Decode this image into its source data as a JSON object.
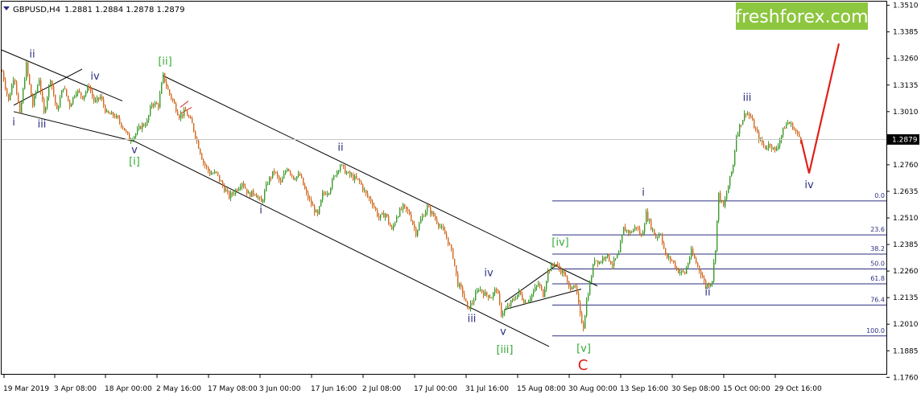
{
  "header": {
    "symbol_label": "GBPUSD,H4",
    "ohlc_text": "1.2881 1.2884 1.2878 1.2879"
  },
  "brand": {
    "text": "freshforex.com",
    "color": "#8dc63f"
  },
  "current_price": {
    "label": "1.2879",
    "value": 1.2879
  },
  "chart_data": {
    "type": "candlestick",
    "title": "GBPUSD,H4",
    "ylim": [
      1.1765,
      1.3535
    ],
    "y_ticks": [
      "1.3510",
      "1.3385",
      "1.3260",
      "1.3135",
      "1.3010",
      "1.2885",
      "1.2760",
      "1.2635",
      "1.2510",
      "1.2385",
      "1.2260",
      "1.2135",
      "1.2010",
      "1.1885",
      "1.1760"
    ],
    "x_ticks": [
      "19 Mar 2019",
      "3 Apr 08:00",
      "18 Apr 00:00",
      "2 May 16:00",
      "17 May 08:00",
      "3 Jun 00:00",
      "17 Jun 16:00",
      "2 Jul 08:00",
      "17 Jul 00:00",
      "31 Jul 16:00",
      "15 Aug 08:00",
      "30 Aug 00:00",
      "13 Sep 16:00",
      "30 Sep 08:00",
      "15 Oct 00:00",
      "29 Oct 16:00"
    ],
    "colors": {
      "up": "#3a9a2a",
      "down": "#d2691e",
      "projection": "#e0201b",
      "wave": "#2c2f80",
      "wave_green": "#33aa33"
    },
    "price_path": [
      [
        0,
        1.32
      ],
      [
        8,
        1.306
      ],
      [
        15,
        1.319
      ],
      [
        22,
        1.299
      ],
      [
        30,
        1.323
      ],
      [
        38,
        1.304
      ],
      [
        46,
        1.3165
      ],
      [
        52,
        1.3
      ],
      [
        60,
        1.317
      ],
      [
        68,
        1.301
      ],
      [
        76,
        1.313
      ],
      [
        84,
        1.304
      ],
      [
        92,
        1.311
      ],
      [
        100,
        1.308
      ],
      [
        108,
        1.313
      ],
      [
        115,
        1.305
      ],
      [
        122,
        1.308
      ],
      [
        130,
        1.3
      ],
      [
        140,
        1.299
      ],
      [
        150,
        1.294
      ],
      [
        158,
        1.288
      ],
      [
        165,
        1.29
      ],
      [
        172,
        1.294
      ],
      [
        180,
        1.296
      ],
      [
        186,
        1.305
      ],
      [
        194,
        1.304
      ],
      [
        200,
        1.318
      ],
      [
        206,
        1.311
      ],
      [
        212,
        1.306
      ],
      [
        220,
        1.299
      ],
      [
        228,
        1.301
      ],
      [
        236,
        1.295
      ],
      [
        243,
        1.286
      ],
      [
        250,
        1.277
      ],
      [
        258,
        1.272
      ],
      [
        266,
        1.272
      ],
      [
        274,
        1.266
      ],
      [
        282,
        1.261
      ],
      [
        290,
        1.264
      ],
      [
        298,
        1.268
      ],
      [
        306,
        1.262
      ],
      [
        314,
        1.263
      ],
      [
        322,
        1.258
      ],
      [
        330,
        1.268
      ],
      [
        338,
        1.273
      ],
      [
        346,
        1.267
      ],
      [
        354,
        1.275
      ],
      [
        362,
        1.27
      ],
      [
        370,
        1.271
      ],
      [
        378,
        1.262
      ],
      [
        386,
        1.256
      ],
      [
        392,
        1.252
      ],
      [
        398,
        1.262
      ],
      [
        406,
        1.264
      ],
      [
        414,
        1.272
      ],
      [
        420,
        1.276
      ],
      [
        428,
        1.272
      ],
      [
        436,
        1.27
      ],
      [
        444,
        1.268
      ],
      [
        452,
        1.262
      ],
      [
        460,
        1.258
      ],
      [
        468,
        1.251
      ],
      [
        476,
        1.253
      ],
      [
        484,
        1.245
      ],
      [
        490,
        1.252
      ],
      [
        498,
        1.256
      ],
      [
        506,
        1.253
      ],
      [
        514,
        1.244
      ],
      [
        520,
        1.25
      ],
      [
        528,
        1.256
      ],
      [
        536,
        1.252
      ],
      [
        544,
        1.247
      ],
      [
        552,
        1.242
      ],
      [
        560,
        1.233
      ],
      [
        566,
        1.22
      ],
      [
        572,
        1.216
      ],
      [
        578,
        1.208
      ],
      [
        585,
        1.212
      ],
      [
        592,
        1.218
      ],
      [
        600,
        1.215
      ],
      [
        608,
        1.214
      ],
      [
        614,
        1.218
      ],
      [
        620,
        1.206
      ],
      [
        626,
        1.208
      ],
      [
        634,
        1.212
      ],
      [
        642,
        1.216
      ],
      [
        650,
        1.211
      ],
      [
        658,
        1.215
      ],
      [
        666,
        1.22
      ],
      [
        672,
        1.215
      ],
      [
        678,
        1.226
      ],
      [
        686,
        1.23
      ],
      [
        692,
        1.227
      ],
      [
        698,
        1.225
      ],
      [
        704,
        1.218
      ],
      [
        710,
        1.22
      ],
      [
        714,
        1.215
      ],
      [
        718,
        1.205
      ],
      [
        722,
        1.2
      ],
      [
        726,
        1.212
      ],
      [
        730,
        1.22
      ],
      [
        736,
        1.232
      ],
      [
        742,
        1.23
      ],
      [
        750,
        1.234
      ],
      [
        758,
        1.229
      ],
      [
        766,
        1.234
      ],
      [
        772,
        1.246
      ],
      [
        780,
        1.244
      ],
      [
        788,
        1.247
      ],
      [
        794,
        1.242
      ],
      [
        800,
        1.253
      ],
      [
        806,
        1.247
      ],
      [
        812,
        1.242
      ],
      [
        818,
        1.244
      ],
      [
        824,
        1.233
      ],
      [
        832,
        1.231
      ],
      [
        840,
        1.226
      ],
      [
        848,
        1.225
      ],
      [
        856,
        1.235
      ],
      [
        862,
        1.23
      ],
      [
        868,
        1.225
      ],
      [
        874,
        1.219
      ],
      [
        878,
        1.22
      ],
      [
        882,
        1.222
      ],
      [
        886,
        1.237
      ],
      [
        890,
        1.262
      ],
      [
        896,
        1.256
      ],
      [
        902,
        1.266
      ],
      [
        908,
        1.276
      ],
      [
        912,
        1.29
      ],
      [
        918,
        1.296
      ],
      [
        924,
        1.301
      ],
      [
        930,
        1.298
      ],
      [
        936,
        1.292
      ],
      [
        942,
        1.287
      ],
      [
        948,
        1.284
      ],
      [
        954,
        1.286
      ],
      [
        960,
        1.282
      ],
      [
        966,
        1.288
      ],
      [
        972,
        1.294
      ],
      [
        976,
        1.296
      ],
      [
        982,
        1.294
      ],
      [
        988,
        1.29
      ],
      [
        993,
        1.2879
      ]
    ],
    "projection": [
      [
        993,
        1.2879
      ],
      [
        1003,
        1.272
      ],
      [
        1040,
        1.333
      ]
    ],
    "fibonacci": {
      "levels": [
        {
          "label": "0.0",
          "price": 1.259
        },
        {
          "label": "23.6",
          "price": 1.243
        },
        {
          "label": "38.2",
          "price": 1.234
        },
        {
          "label": "50.0",
          "price": 1.227
        },
        {
          "label": "61.8",
          "price": 1.22
        },
        {
          "label": "76.4",
          "price": 1.21
        },
        {
          "label": "100.0",
          "price": 1.1955
        }
      ]
    },
    "trendlines": [
      {
        "name": "channel-upper-main",
        "from": [
          200,
          1.318
        ],
        "to": [
          740,
          1.219
        ]
      },
      {
        "name": "channel-lower-main",
        "from": [
          160,
          1.288
        ],
        "to": [
          680,
          1.1905
        ]
      },
      {
        "name": "wedge-upper",
        "from": [
          0,
          1.33
        ],
        "to": [
          150,
          1.306
        ]
      },
      {
        "name": "wedge-lower",
        "from": [
          15,
          1.301
        ],
        "to": [
          165,
          1.287
        ]
      },
      {
        "name": "wedge-cross",
        "from": [
          15,
          1.304
        ],
        "to": [
          100,
          1.321
        ]
      },
      {
        "name": "iv-triangle-upper",
        "from": [
          625,
          1.2115
        ],
        "to": [
          690,
          1.229
        ]
      },
      {
        "name": "iv-triangle-lower",
        "from": [
          625,
          1.208
        ],
        "to": [
          720,
          1.2175
        ]
      },
      {
        "name": "red-box-1",
        "from": [
          222,
          1.303
        ],
        "to": [
          232,
          1.306
        ],
        "color": "#e0201b"
      },
      {
        "name": "red-box-2",
        "from": [
          222,
          1.3
        ],
        "to": [
          236,
          1.303
        ],
        "color": "#e0201b"
      }
    ],
    "wave_labels": [
      {
        "text": "ii",
        "x": 38,
        "price": 1.3265,
        "color": "#2c2f80"
      },
      {
        "text": "iv",
        "x": 116,
        "price": 1.316,
        "color": "#2c2f80"
      },
      {
        "text": "i",
        "x": 15,
        "price": 1.2945,
        "color": "#2c2f80"
      },
      {
        "text": "iii",
        "x": 50,
        "price": 1.2935,
        "color": "#2c2f80"
      },
      {
        "text": "v",
        "x": 165,
        "price": 1.2815,
        "color": "#2c2f80"
      },
      {
        "text": "[i]",
        "x": 165,
        "price": 1.276,
        "color": "#33aa33"
      },
      {
        "text": "[ii]",
        "x": 203,
        "price": 1.323,
        "color": "#33aa33"
      },
      {
        "text": "i",
        "x": 322,
        "price": 1.253,
        "color": "#2c2f80"
      },
      {
        "text": "ii",
        "x": 421,
        "price": 1.2825,
        "color": "#2c2f80"
      },
      {
        "text": "iv",
        "x": 605,
        "price": 1.2235,
        "color": "#2c2f80"
      },
      {
        "text": "iii",
        "x": 584,
        "price": 1.202,
        "color": "#2c2f80"
      },
      {
        "text": "v",
        "x": 623,
        "price": 1.196,
        "color": "#2c2f80"
      },
      {
        "text": "[iii]",
        "x": 625,
        "price": 1.1875,
        "color": "#33aa33"
      },
      {
        "text": "[iv]",
        "x": 694,
        "price": 1.238,
        "color": "#33aa33"
      },
      {
        "text": "[v]",
        "x": 723,
        "price": 1.188,
        "color": "#33aa33"
      },
      {
        "text": "C",
        "x": 722,
        "price": 1.1795,
        "color": "#e0201b",
        "big": true
      },
      {
        "text": "i",
        "x": 797,
        "price": 1.2615,
        "color": "#2c2f80"
      },
      {
        "text": "ii",
        "x": 877,
        "price": 1.2145,
        "color": "#2c2f80"
      },
      {
        "text": "iii",
        "x": 926,
        "price": 1.306,
        "color": "#2c2f80"
      },
      {
        "text": "iv",
        "x": 1003,
        "price": 1.265,
        "color": "#2c2f80"
      }
    ]
  }
}
